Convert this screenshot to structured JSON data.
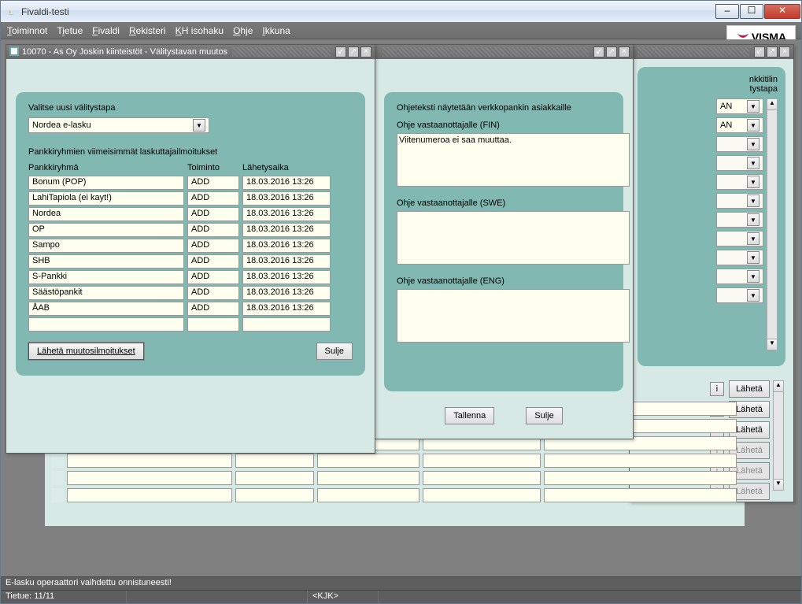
{
  "os_window": {
    "title": "Fivaldi-testi"
  },
  "menubar": {
    "items": [
      "Toiminnot",
      "Tietue",
      "Fivaldi",
      "Rekisteri",
      "KH isohaku",
      "Ohje",
      "Ikkuna"
    ]
  },
  "brand": "VISMA",
  "dialog": {
    "title": "10070 - As Oy Joskin kiinteistöt - Välitystavan muutos",
    "valitse_label": "Valitse uusi välitystapa",
    "valitse_value": "Nordea e-lasku",
    "sub_label": "Pankkiryhmien viimeisimmät laskuttajailmoitukset",
    "columns": {
      "a": "Pankkiryhmä",
      "b": "Toiminto",
      "c": "Lähetysaika"
    },
    "rows": [
      {
        "a": "Bonum (POP)",
        "b": "ADD",
        "c": "18.03.2016 13:26"
      },
      {
        "a": "LahiTapiola (ei kayt!)",
        "b": "ADD",
        "c": "18.03.2016 13:26"
      },
      {
        "a": "Nordea",
        "b": "ADD",
        "c": "18.03.2016 13:26"
      },
      {
        "a": "OP",
        "b": "ADD",
        "c": "18.03.2016 13:26"
      },
      {
        "a": "Sampo",
        "b": "ADD",
        "c": "18.03.2016 13:26"
      },
      {
        "a": "SHB",
        "b": "ADD",
        "c": "18.03.2016 13:26"
      },
      {
        "a": "S-Pankki",
        "b": "ADD",
        "c": "18.03.2016 13:26"
      },
      {
        "a": "Säästöpankit",
        "b": "ADD",
        "c": "18.03.2016 13:26"
      },
      {
        "a": "ÅAB",
        "b": "ADD",
        "c": "18.03.2016 13:26"
      },
      {
        "a": "",
        "b": "",
        "c": ""
      }
    ],
    "btn_send": "Lähetä muutosilmoitukset",
    "btn_close": "Sulje"
  },
  "ohje_panel": {
    "header": "Ohjeteksti näytetään verkkopankin asiakkaille",
    "fin_label": "Ohje vastaanottajalle (FIN)",
    "fin_text": "Viitenumeroa ei saa muuttaa.",
    "swe_label": "Ohje vastaanottajalle (SWE)",
    "swe_text": "",
    "eng_label": "Ohje vastaanottajalle (ENG)",
    "eng_text": "",
    "btn_save": "Tallenna",
    "btn_close": "Sulje"
  },
  "side_panel": {
    "label1": "nkkitilin",
    "label2": "tystapa",
    "combo_value": "AN",
    "row_btn_i": "i",
    "row_btn_send": "Lähetä"
  },
  "status": {
    "line1": "E-lasku operaattori vaihdettu onnistuneesti!",
    "record": "Tietue: 11/11",
    "user": "<KJK>"
  }
}
